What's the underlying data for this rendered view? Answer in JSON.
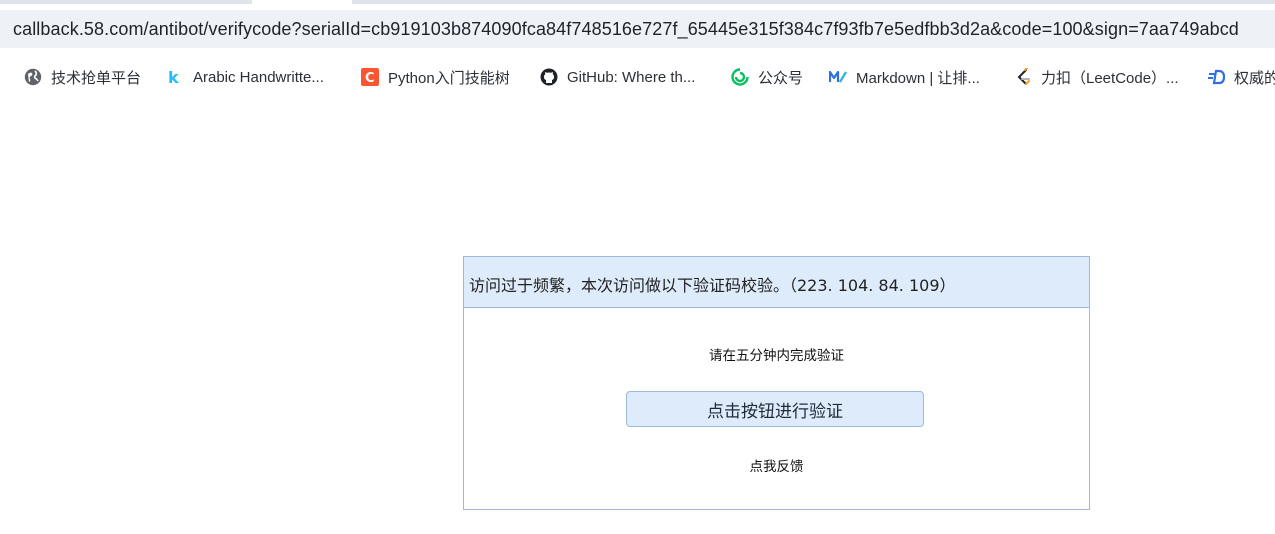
{
  "browser": {
    "url": "callback.58.com/antibot/verifycode?serialId=cb919103b874090fca84f748516e727f_65445e315f384c7f93fb7e5edfbb3d2a&code=100&sign=7aa749abcd",
    "bookmarks": [
      {
        "label": "技术抢单平台",
        "icon": "globe-icon",
        "color": "#5f6368"
      },
      {
        "label": "Arabic Handwritte...",
        "icon": "kaggle-icon",
        "color": "#20beff"
      },
      {
        "label": "Python入门技能树",
        "icon": "csdn-icon",
        "color": "#fc5531"
      },
      {
        "label": "GitHub: Where th...",
        "icon": "github-icon",
        "color": "#1f2328"
      },
      {
        "label": "公众号",
        "icon": "wechat-icon",
        "color": "#07c160"
      },
      {
        "label": "Markdown | 让排...",
        "icon": "markdown-icon",
        "color": "#2f6fe0"
      },
      {
        "label": "力扣（LeetCode）...",
        "icon": "leetcode-icon",
        "color": "#f89f1b"
      },
      {
        "label": "权威的",
        "icon": "deepl-icon",
        "color": "#2f6fe0"
      }
    ]
  },
  "verify": {
    "header": "访问过于频繁，本次访问做以下验证码校验。（223. 104. 84. 109）",
    "hint": "请在五分钟内完成验证",
    "button_label": "点击按钮进行验证",
    "feedback_label": "点我反馈",
    "colors": {
      "header_bg": "#deebfb",
      "border": "#9dbad9"
    }
  }
}
